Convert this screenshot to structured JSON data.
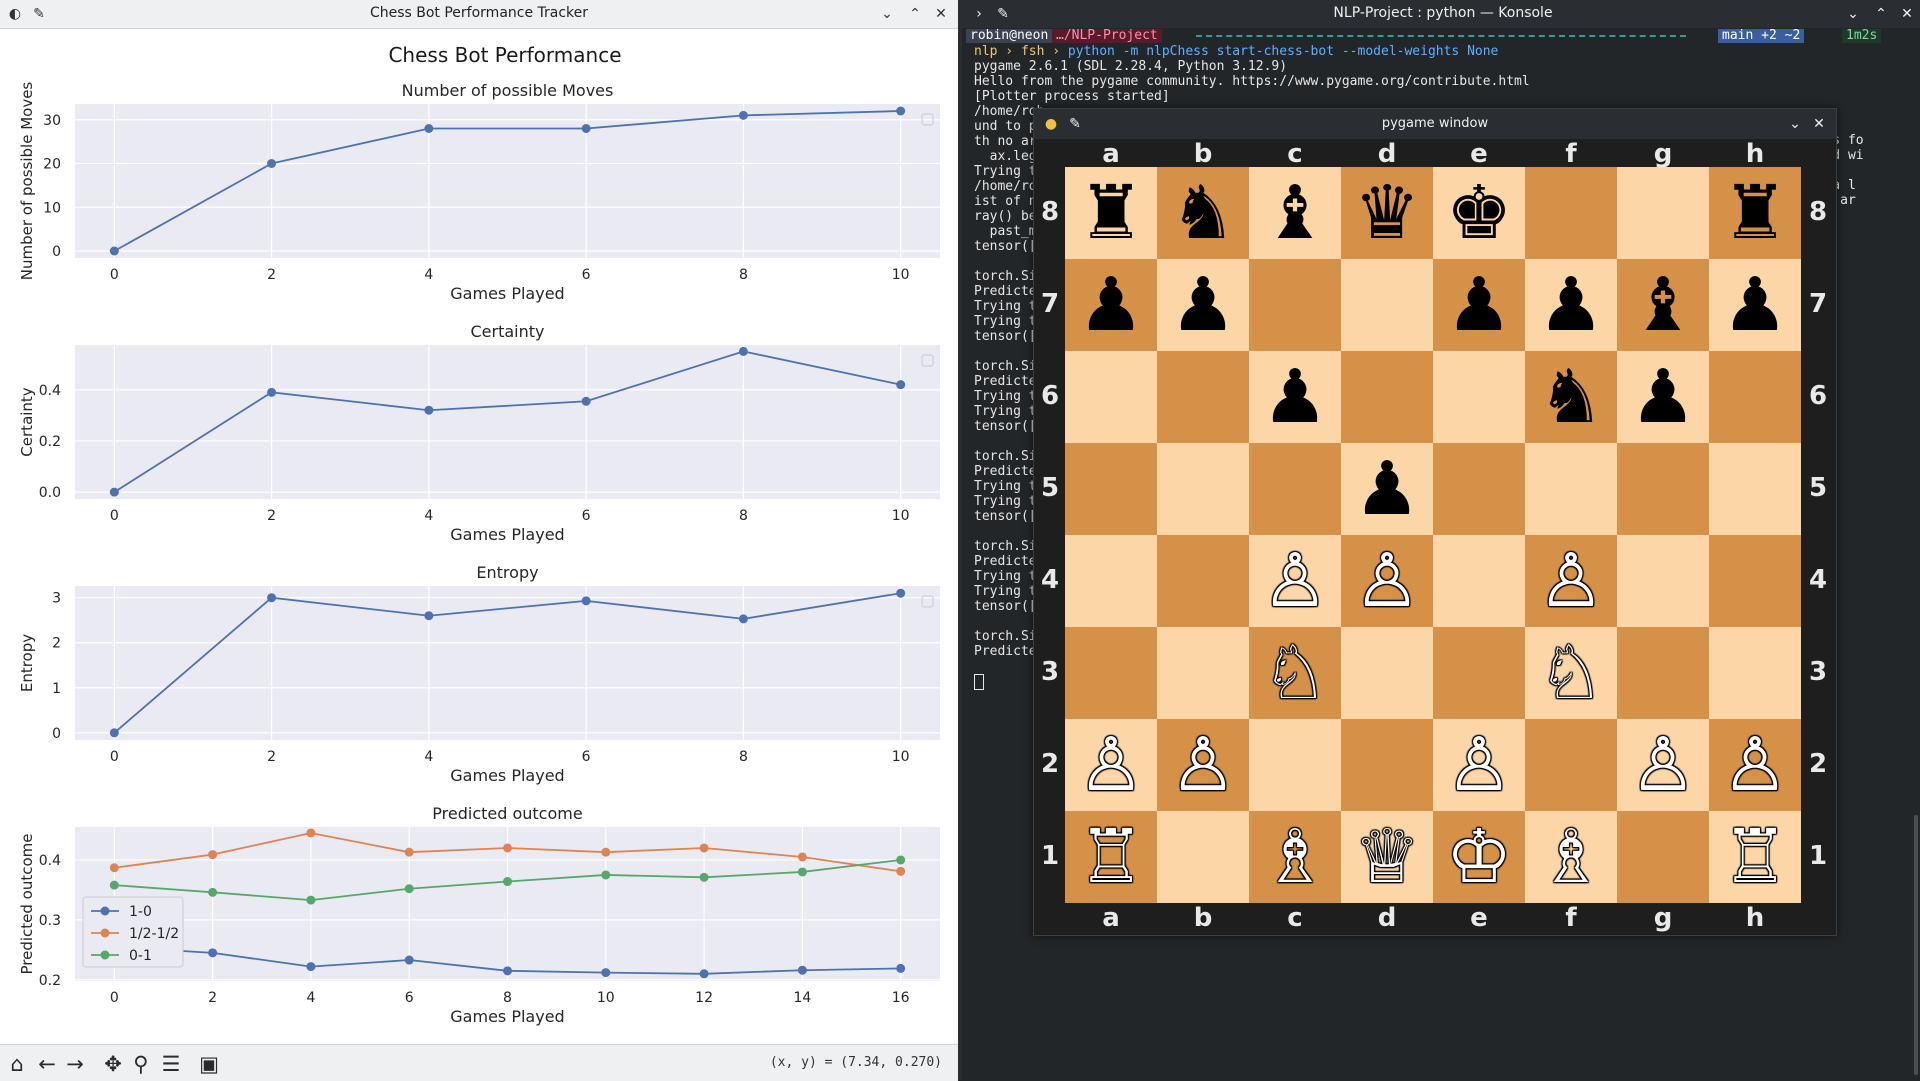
{
  "mpl": {
    "title": "Chess Bot Performance Tracker",
    "suptitle": "Chess Bot Performance",
    "status": "(x, y) = (7.34, 0.270)",
    "toolbar": [
      "home-icon",
      "back-icon",
      "forward-icon",
      "pan-icon",
      "zoom-icon",
      "configure-icon",
      "save-icon"
    ]
  },
  "chart_data": [
    {
      "type": "line",
      "title": "Number of possible Moves",
      "xlabel": "Games Played",
      "ylabel": "Number of possible Moves",
      "x": [
        0,
        2,
        4,
        6,
        8,
        10
      ],
      "xticks": [
        0,
        2,
        4,
        6,
        8,
        10
      ],
      "yticks": [
        0,
        10,
        20,
        30
      ],
      "xlim": [
        -0.5,
        10.5
      ],
      "ylim": [
        -1.6,
        33.6
      ],
      "series": [
        {
          "values": [
            0,
            20,
            28,
            28,
            31,
            32
          ],
          "color": "#4c72b0"
        }
      ],
      "grid": true
    },
    {
      "type": "line",
      "title": "Certainty",
      "xlabel": "Games Played",
      "ylabel": "Certainty",
      "x": [
        0,
        2,
        4,
        6,
        8,
        10
      ],
      "xticks": [
        0,
        2,
        4,
        6,
        8,
        10
      ],
      "yticks": [
        0.0,
        0.2,
        0.4
      ],
      "ytick_labels": [
        "0.0",
        "0.2",
        "0.4"
      ],
      "xlim": [
        -0.5,
        10.5
      ],
      "ylim": [
        -0.027,
        0.575
      ],
      "series": [
        {
          "values": [
            0,
            0.39,
            0.32,
            0.355,
            0.55,
            0.42
          ],
          "color": "#4c72b0"
        }
      ],
      "grid": true
    },
    {
      "type": "line",
      "title": "Entropy",
      "xlabel": "Games Played",
      "ylabel": "Entropy",
      "x": [
        0,
        2,
        4,
        6,
        8,
        10
      ],
      "xticks": [
        0,
        2,
        4,
        6,
        8,
        10
      ],
      "yticks": [
        0,
        1,
        2,
        3
      ],
      "xlim": [
        -0.5,
        10.5
      ],
      "ylim": [
        -0.16,
        3.26
      ],
      "series": [
        {
          "values": [
            0,
            3.0,
            2.6,
            2.93,
            2.53,
            3.1
          ],
          "color": "#4c72b0"
        }
      ],
      "grid": true
    },
    {
      "type": "line",
      "title": "Predicted outcome",
      "xlabel": "Games Played",
      "ylabel": "Predicted outcome",
      "x": [
        0,
        2,
        4,
        6,
        8,
        10,
        12,
        14,
        16
      ],
      "xticks": [
        0,
        2,
        4,
        6,
        8,
        10,
        12,
        14,
        16
      ],
      "yticks": [
        0.2,
        0.3,
        0.4
      ],
      "ytick_labels": [
        "0.2",
        "0.3",
        "0.4"
      ],
      "xlim": [
        -0.8,
        16.8
      ],
      "ylim": [
        0.198,
        0.455
      ],
      "series": [
        {
          "name": "1-0",
          "values": [
            0.255,
            0.245,
            0.222,
            0.233,
            0.215,
            0.212,
            0.21,
            0.216,
            0.219
          ],
          "color": "#4c72b0"
        },
        {
          "name": "1/2-1/2",
          "values": [
            0.387,
            0.409,
            0.445,
            0.413,
            0.42,
            0.413,
            0.42,
            0.405,
            0.381
          ],
          "color": "#dd8452"
        },
        {
          "name": "0-1",
          "values": [
            0.358,
            0.346,
            0.333,
            0.352,
            0.364,
            0.375,
            0.371,
            0.38,
            0.4
          ],
          "color": "#55a868"
        }
      ],
      "legend": "bottom-left",
      "grid": true
    }
  ],
  "konsole": {
    "title": "NLP-Project : python — Konsole",
    "prompt": {
      "user": "robin@neon",
      "path": "…/NLP-Project",
      "branch": "main +2 ~2",
      "time": "1m2s"
    },
    "command_prefix": "nlp › fsh ›",
    "command": "python -m nlpChess start-chess-bot --model-weights None",
    "lines": [
      "pygame 2.6.1 (SDL 2.28.4, Python 3.12.9)",
      "Hello from the pygame community. https://www.pygame.org/contribute.html",
      "[Plotter process started]",
      "/home/rob",
      "und to pu",
      "th no arg",
      "  ax.lege",
      "Trying to",
      "/home/rob",
      "ist of nu",
      "ray() bef",
      "  past_mo",
      "tensor([2",
      "",
      "torch.Siz",
      "Predicted",
      "Trying to",
      "Trying to",
      "tensor([3",
      "",
      "torch.Siz",
      "Predicted",
      "Trying to",
      "Trying to",
      "tensor([1",
      "",
      "torch.Siz",
      "Predicted",
      "Trying to",
      "Trying to",
      "tensor([1",
      "",
      "torch.Siz",
      "Predicted",
      "Trying to",
      "Trying to",
      "tensor([8",
      "",
      "torch.Siz",
      "Predicted"
    ],
    "right_fragments": [
      "abels fo",
      "alled wi",
      "rom a l",
      "umpy.ar"
    ]
  },
  "pygame": {
    "title": "pygame window",
    "files": [
      "a",
      "b",
      "c",
      "d",
      "e",
      "f",
      "g",
      "h"
    ],
    "ranks": [
      "8",
      "7",
      "6",
      "5",
      "4",
      "3",
      "2",
      "1"
    ],
    "board": [
      [
        "bR",
        "bN",
        "bB",
        "bQ",
        "bK",
        "",
        "",
        "bR"
      ],
      [
        "bP",
        "bP",
        "",
        "",
        "bP",
        "bP",
        "bB",
        "bP"
      ],
      [
        "",
        "",
        "bP",
        "",
        "",
        "bN",
        "bP",
        ""
      ],
      [
        "",
        "",
        "",
        "bP",
        "",
        "",
        "",
        ""
      ],
      [
        "",
        "",
        "wP",
        "wP",
        "",
        "wP",
        "",
        ""
      ],
      [
        "",
        "",
        "wN",
        "",
        "",
        "wN",
        "",
        ""
      ],
      [
        "wP",
        "wP",
        "",
        "",
        "wP",
        "",
        "wP",
        "wP"
      ],
      [
        "wR",
        "",
        "wB",
        "wQ",
        "wK",
        "wB",
        "",
        "wR"
      ]
    ]
  }
}
